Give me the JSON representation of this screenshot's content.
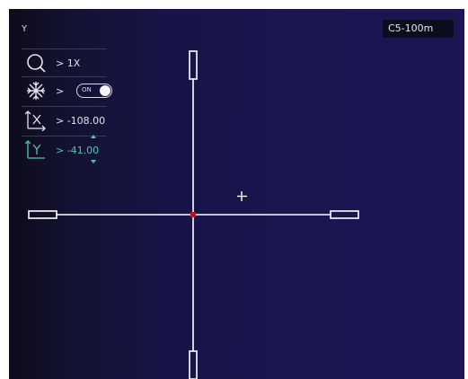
{
  "mode_label": "Y",
  "profile": "C5-100m",
  "menu": {
    "zoom": {
      "icon": "zoom-icon",
      "value": "> 1X"
    },
    "freeze": {
      "icon": "freeze-icon",
      "arrow": ">",
      "toggle_label": "ON",
      "toggle_state": "on"
    },
    "x_offset": {
      "icon": "x-axis-icon",
      "value": "> -108.00"
    },
    "y_offset": {
      "icon": "y-axis-icon",
      "value": "> -41.00",
      "active": true
    }
  },
  "colors": {
    "accent": "#4fc7b3",
    "reticle": "#ffffff",
    "center_dot": "#c0101a",
    "background": "#1a1650"
  }
}
